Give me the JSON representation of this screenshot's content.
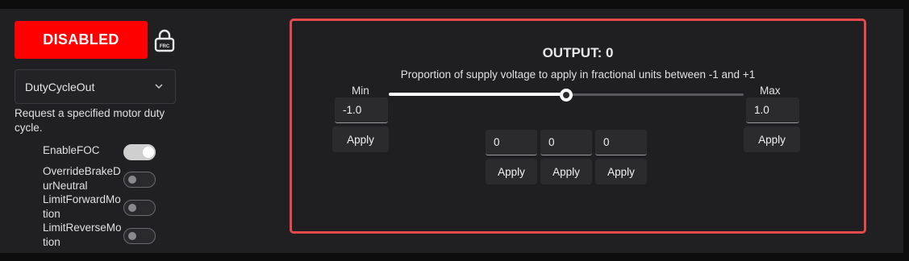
{
  "header": {
    "enable_label": "DISABLED",
    "lock_icon": "lock-frc-icon"
  },
  "control": {
    "mode_selected": "DutyCycleOut",
    "description": "Request a specified motor duty cycle."
  },
  "options": [
    {
      "label": "EnableFOC",
      "on": true
    },
    {
      "label": "OverrideBrakeDurNeutral",
      "on": false
    },
    {
      "label": "LimitForwardMotion",
      "on": false
    },
    {
      "label": "LimitReverseMotion",
      "on": false
    }
  ],
  "output": {
    "title": "OUTPUT: 0",
    "description": "Proportion of supply voltage to apply in fractional units between -1 and +1",
    "min_label": "Min",
    "max_label": "Max",
    "min_value": "-1.0",
    "max_value": "1.0",
    "slider_value": 0,
    "slider_min": -1,
    "slider_max": 1,
    "apply_label": "Apply",
    "preset_values": [
      "0",
      "0",
      "0"
    ]
  },
  "colors": {
    "disabled_bg": "#ff0000",
    "panel_border": "#e5484d",
    "background": "#202023"
  }
}
